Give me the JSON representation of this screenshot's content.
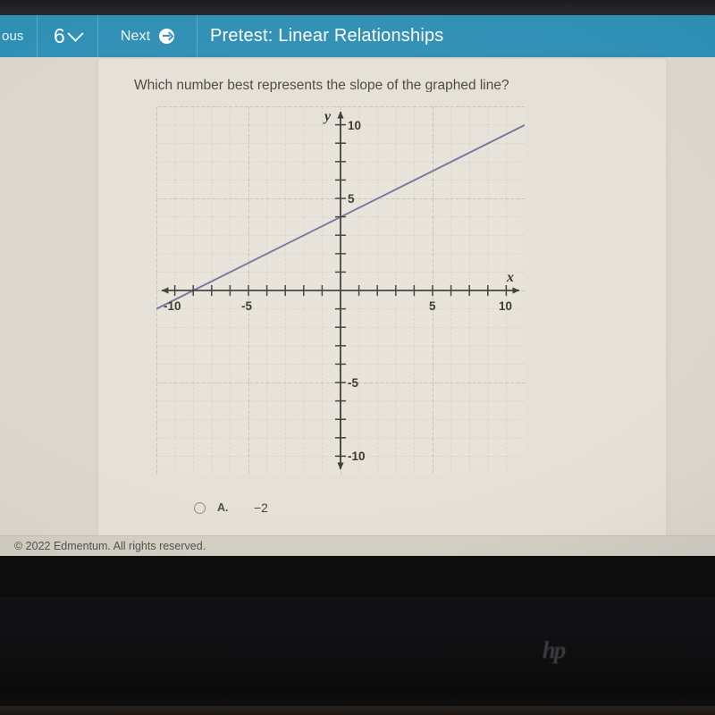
{
  "header": {
    "prev_label": "ous",
    "question_number": "6",
    "next_label": "Next",
    "title": "Pretest: Linear Relationships",
    "accent_color": "#2f8fb5",
    "chevron_icon": "chevron-down-icon",
    "next_icon": "arrow-right-circle-icon"
  },
  "question": {
    "text": "Which number best represents the slope of the graphed line?"
  },
  "options": [
    {
      "letter": "A.",
      "value": "−2",
      "selected": false
    }
  ],
  "footer": {
    "copyright": "© 2022 Edmentum. All rights reserved."
  },
  "shelf": {
    "launcher_icon": "launcher-circle-icon",
    "chrome_icon": "chrome-browser-icon"
  },
  "device": {
    "brand": "hp"
  },
  "chart_data": {
    "type": "line",
    "title": "",
    "xlabel": "x",
    "ylabel": "y",
    "xlim": [
      -10,
      10
    ],
    "ylim": [
      -10,
      10
    ],
    "grid": true,
    "grid_step": 1,
    "major_grid_step": 5,
    "x_ticks": [
      -10,
      -5,
      5,
      10
    ],
    "x_tick_labels": [
      "-10",
      "-5",
      "5",
      "10"
    ],
    "y_ticks": [
      -10,
      -5,
      5,
      10
    ],
    "y_tick_labels": [
      "-10",
      "-5",
      "5",
      "10"
    ],
    "tick_step": 1,
    "line_color": "#6e6e9b",
    "series": [
      {
        "name": "graphed line",
        "equation": "y = 0.5x + 4",
        "slope": 0.5,
        "y_intercept": 4,
        "x_intercept": -8,
        "points": [
          [
            -10,
            -1
          ],
          [
            -8,
            0
          ],
          [
            0,
            4
          ],
          [
            10,
            9
          ]
        ]
      }
    ],
    "axis_arrows": [
      "left",
      "right",
      "up",
      "down"
    ]
  }
}
